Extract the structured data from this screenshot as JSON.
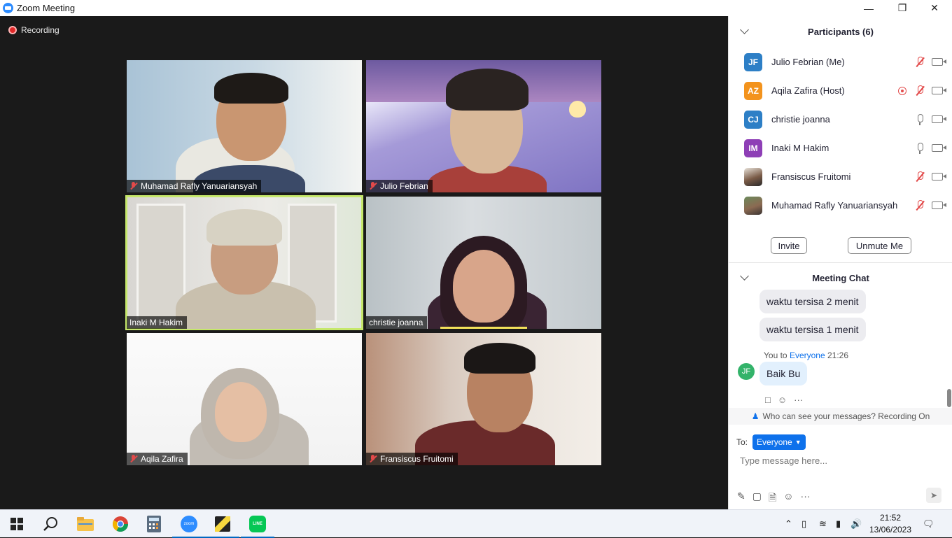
{
  "window": {
    "title": "Zoom Meeting",
    "recording_label": "Recording"
  },
  "tiles": [
    {
      "name": "Muhamad Rafly Yanuariansyah",
      "muted": true
    },
    {
      "name": "Julio Febrian",
      "muted": true
    },
    {
      "name": "Inaki M Hakim",
      "muted": false,
      "active_speaker": true
    },
    {
      "name": "christie joanna",
      "muted": false
    },
    {
      "name": "Aqila Zafira",
      "muted": true
    },
    {
      "name": "Fransiscus Fruitomi",
      "muted": true
    }
  ],
  "participants": {
    "header": "Participants (6)",
    "list": [
      {
        "initials": "JF",
        "name": "Julio Febrian (Me)",
        "color": "#2d7fc6",
        "mic": "muted"
      },
      {
        "initials": "AZ",
        "name": "Aqila Zafira (Host)",
        "color": "#f3931d",
        "mic": "muted",
        "recording": true
      },
      {
        "initials": "CJ",
        "name": "christie joanna",
        "color": "#2d7fc6",
        "mic": "on"
      },
      {
        "initials": "IM",
        "name": "Inaki M Hakim",
        "color": "#8e3fb6",
        "mic": "on"
      },
      {
        "initials": "",
        "name": "Fransiscus Fruitomi",
        "color": "#5a4a3a",
        "mic": "muted"
      },
      {
        "initials": "",
        "name": "Muhamad Rafly Yanuariansyah",
        "color": "#4a6a3a",
        "mic": "muted"
      }
    ],
    "invite_label": "Invite",
    "unmute_label": "Unmute Me"
  },
  "chat": {
    "header": "Meeting Chat",
    "messages": [
      {
        "text": "waktu tersisa 2 menit"
      },
      {
        "text": "waktu tersisa 1 menit"
      }
    ],
    "self_meta_from": "You to",
    "self_meta_to": "Everyone",
    "self_meta_time": "21:26",
    "self_avatar": "JF",
    "self_message": "Baik Bu",
    "visibility_note": "Who can see your messages? Recording On",
    "to_label": "To:",
    "to_value": "Everyone",
    "input_placeholder": "Type message here..."
  },
  "taskbar": {
    "time": "21:52",
    "date": "13/06/2023",
    "zoom_label": "zoom",
    "line_label": "LINE"
  },
  "colors": {
    "accent": "#0e71eb",
    "active_border": "#c6e86b",
    "mute_red": "#e24a4a"
  }
}
